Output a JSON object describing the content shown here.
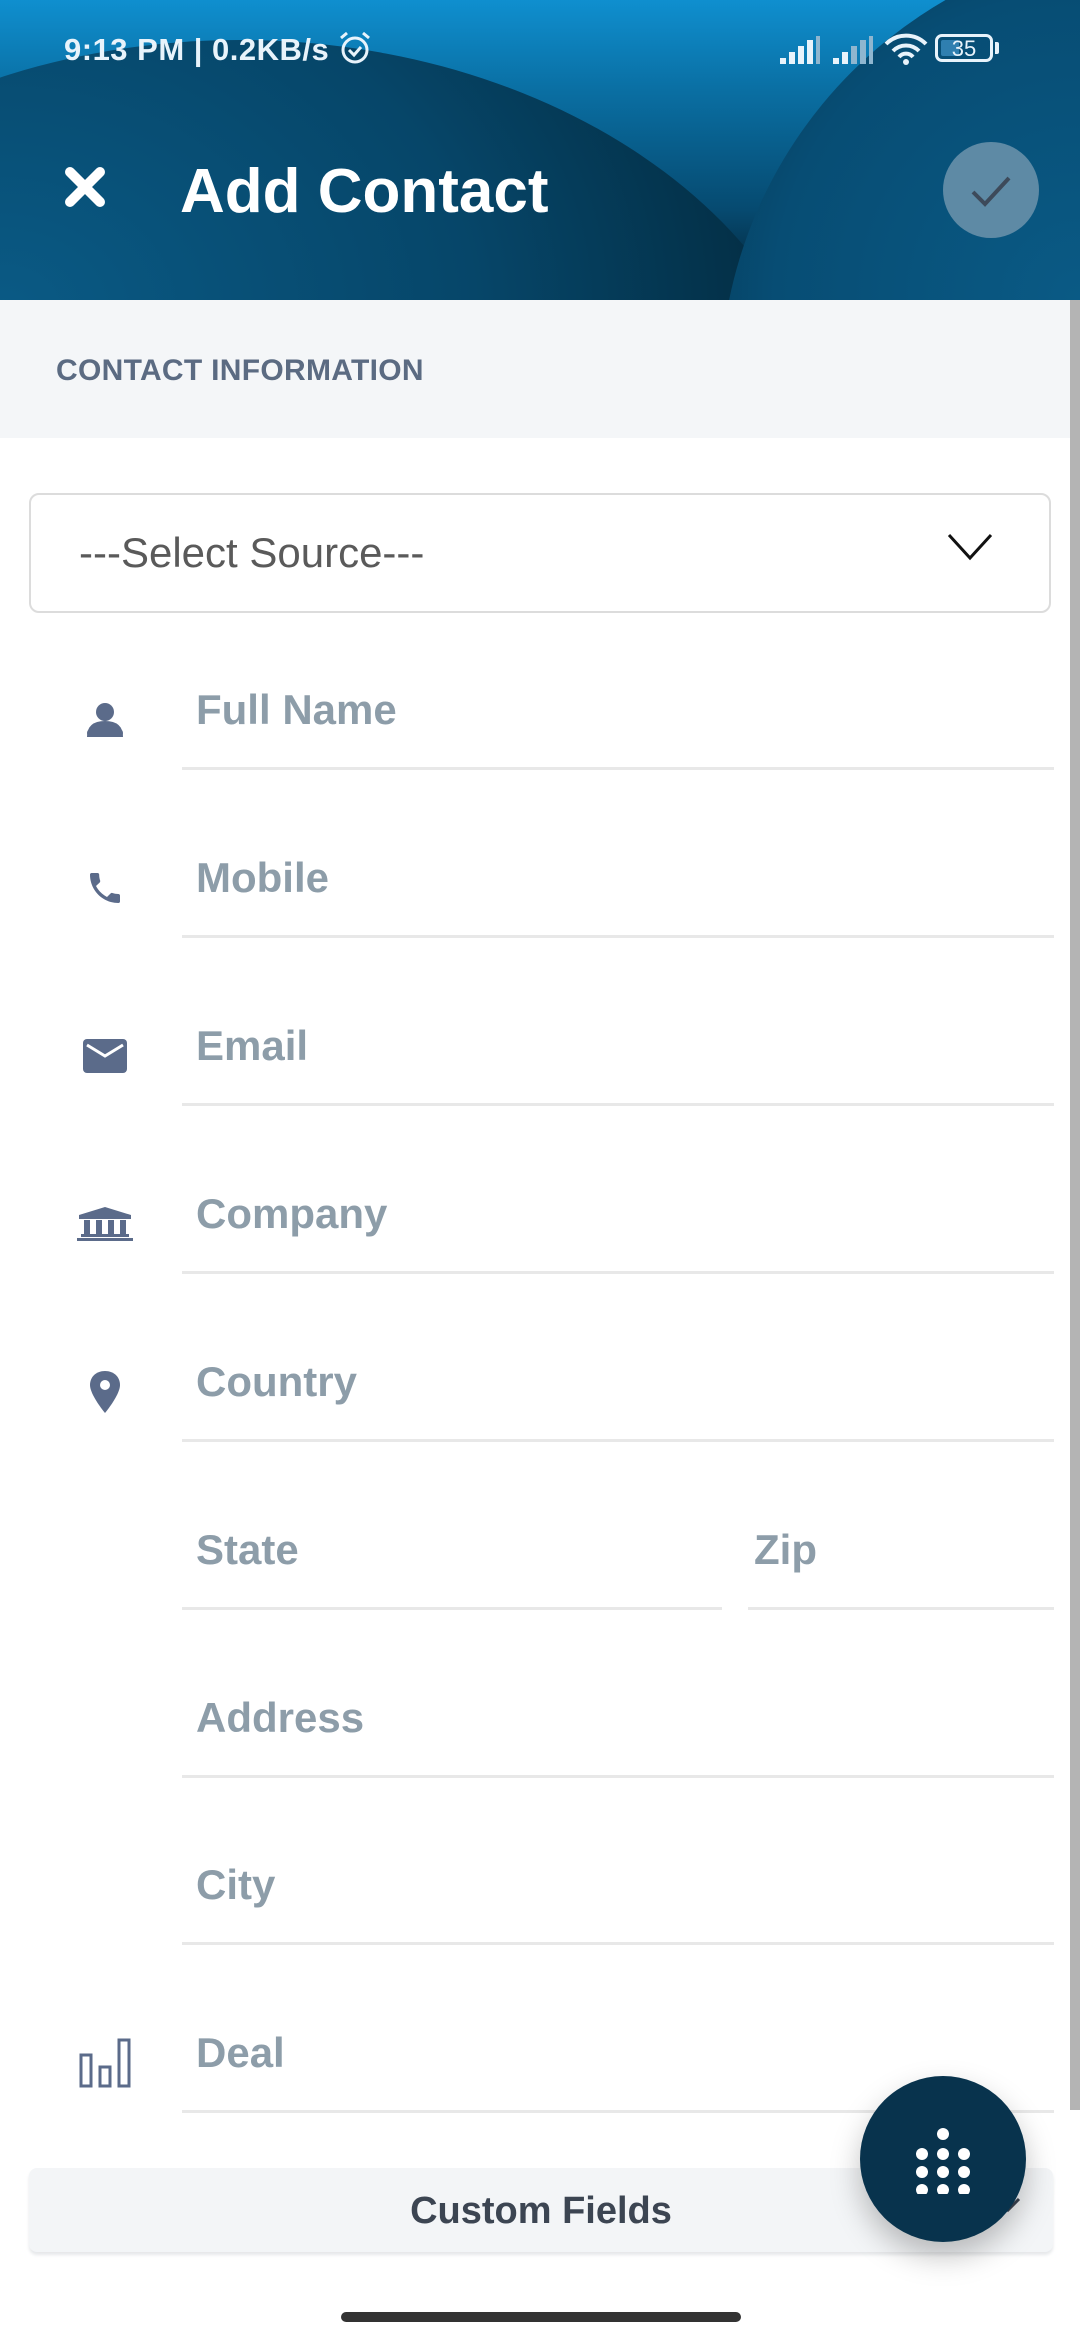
{
  "status_bar": {
    "time": "9:13 PM | 0.2KB/s",
    "battery": "35",
    "icons": [
      "alarm-icon",
      "signal-icon",
      "signal-icon",
      "wifi-icon",
      "battery-icon"
    ]
  },
  "header": {
    "title": "Add Contact",
    "close_icon": "close-icon",
    "save_icon": "check-icon"
  },
  "section": {
    "label": "CONTACT INFORMATION"
  },
  "source_select": {
    "selected": "---Select Source---"
  },
  "fields": {
    "full_name": {
      "placeholder": "Full Name",
      "value": "",
      "icon": "person-icon"
    },
    "mobile": {
      "placeholder": "Mobile",
      "value": "",
      "icon": "phone-icon"
    },
    "email": {
      "placeholder": "Email",
      "value": "",
      "icon": "mail-icon"
    },
    "company": {
      "placeholder": "Company",
      "value": "",
      "icon": "bank-icon"
    },
    "country": {
      "placeholder": "Country",
      "value": "",
      "icon": "location-pin-icon"
    },
    "state": {
      "placeholder": "State",
      "value": ""
    },
    "zip": {
      "placeholder": "Zip",
      "value": ""
    },
    "address": {
      "placeholder": "Address",
      "value": ""
    },
    "city": {
      "placeholder": "City",
      "value": ""
    },
    "deal": {
      "placeholder": "Deal",
      "value": "",
      "icon": "bar-chart-icon"
    }
  },
  "custom_fields": {
    "label": "Custom Fields"
  },
  "fab": {
    "icon": "dialpad-icon"
  },
  "colors": {
    "header_dark": "#064669",
    "icon": "#5b6b8a",
    "placeholder": "#8d9da9",
    "fab": "#08334d"
  }
}
